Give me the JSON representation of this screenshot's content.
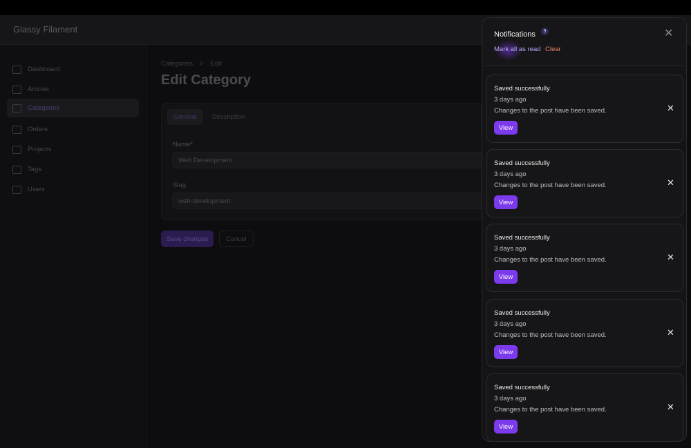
{
  "app": {
    "brand": "Glassy Filament"
  },
  "sidebar": {
    "items": [
      {
        "label": "Dashboard",
        "icon": "home-icon"
      },
      {
        "label": "Articles",
        "icon": "folder-icon"
      },
      {
        "label": "Categories",
        "icon": "folder-icon",
        "active": true
      },
      {
        "label": "Orders",
        "icon": "folder-icon"
      },
      {
        "label": "Projects",
        "icon": "folder-icon"
      },
      {
        "label": "Tags",
        "icon": "folder-icon"
      },
      {
        "label": "Users",
        "icon": "folder-icon"
      }
    ]
  },
  "breadcrumb": {
    "root": "Categories",
    "separator": ">",
    "current": "Edit"
  },
  "page": {
    "title": "Edit Category"
  },
  "form": {
    "tabs": [
      "General",
      "Description"
    ],
    "name_label": "Name*",
    "name_value": "Web Development",
    "slug_label": "Slug",
    "slug_value": "web-development",
    "save_label": "Save changes",
    "cancel_label": "Cancel"
  },
  "notifications": {
    "title": "Notifications",
    "count": "9",
    "mark_all_label": "Mark all as read",
    "clear_label": "Clear",
    "close_icon": "close-icon",
    "items": [
      {
        "title": "Saved successfully",
        "time": "3 days ago",
        "body": "Changes to the post have been saved.",
        "action": "View"
      },
      {
        "title": "Saved successfully",
        "time": "3 days ago",
        "body": "Changes to the post have been saved.",
        "action": "View"
      },
      {
        "title": "Saved successfully",
        "time": "3 days ago",
        "body": "Changes to the post have been saved.",
        "action": "View"
      },
      {
        "title": "Saved successfully",
        "time": "3 days ago",
        "body": "Changes to the post have been saved.",
        "action": "View"
      },
      {
        "title": "Saved successfully",
        "time": "3 days ago",
        "body": "Changes to the post have been saved.",
        "action": "View"
      }
    ]
  },
  "colors": {
    "accent": "#7c3aed",
    "danger": "#e8826e",
    "panel_bg": "#141416"
  }
}
